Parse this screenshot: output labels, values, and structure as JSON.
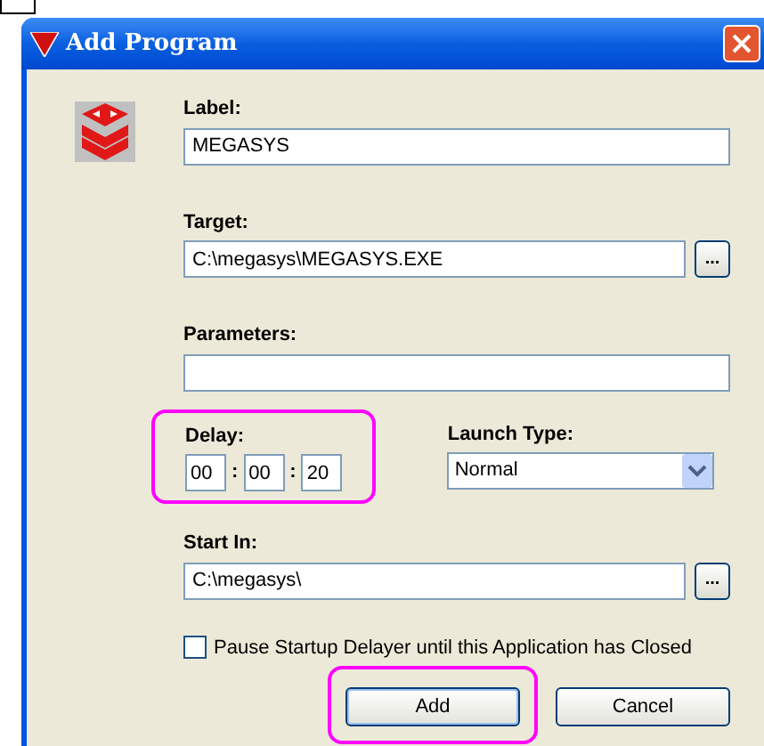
{
  "window": {
    "title": "Add Program"
  },
  "fields": {
    "label": {
      "caption": "Label:",
      "value": "MEGASYS"
    },
    "target": {
      "caption": "Target:",
      "value": "C:\\megasys\\MEGASYS.EXE",
      "browse": "..."
    },
    "parameters": {
      "caption": "Parameters:"
    },
    "delay": {
      "caption": "Delay:",
      "parts": [
        "00",
        "00",
        "20"
      ],
      "separator": ":"
    },
    "launch_type": {
      "caption": "Launch Type:",
      "value": "Normal"
    },
    "start_in": {
      "caption": "Start In:",
      "value": "C:\\megasys\\",
      "browse": "..."
    }
  },
  "pause_option": {
    "label": "Pause Startup Delayer until this Application has Closed",
    "checked": false
  },
  "buttons": [
    {
      "label": "Add",
      "highlighted": true
    },
    {
      "label": "Cancel",
      "highlighted": false
    }
  ]
}
